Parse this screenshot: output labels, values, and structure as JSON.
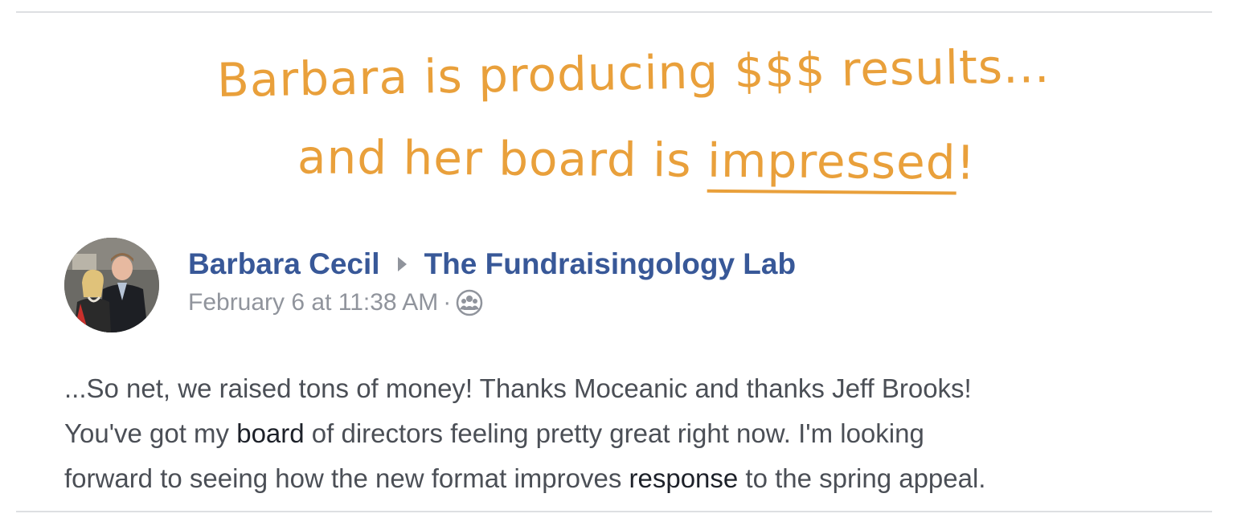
{
  "headline": {
    "line1": "Barbara is producing $$$ results...",
    "line2_prefix": "and her board is ",
    "line2_underlined": "impressed",
    "line2_suffix": "!",
    "color": "#e9a03b"
  },
  "post": {
    "author": "Barbara Cecil",
    "group": "The Fundraisingology Lab",
    "timestamp": "February 6 at 11:38 AM",
    "separator": "·",
    "audience_icon": "group-icon",
    "name_color": "#385898",
    "body": {
      "line1": "...So net, we raised tons of money! Thanks Moceanic and thanks Jeff Brooks!",
      "line2_before": "You've got my ",
      "line2_highlight": "board",
      "line2_after": " of directors feeling pretty great right now. I'm looking",
      "line3_before": "forward to seeing how the new format improves ",
      "line3_highlight": "response",
      "line3_after": " to the spring appeal."
    }
  }
}
